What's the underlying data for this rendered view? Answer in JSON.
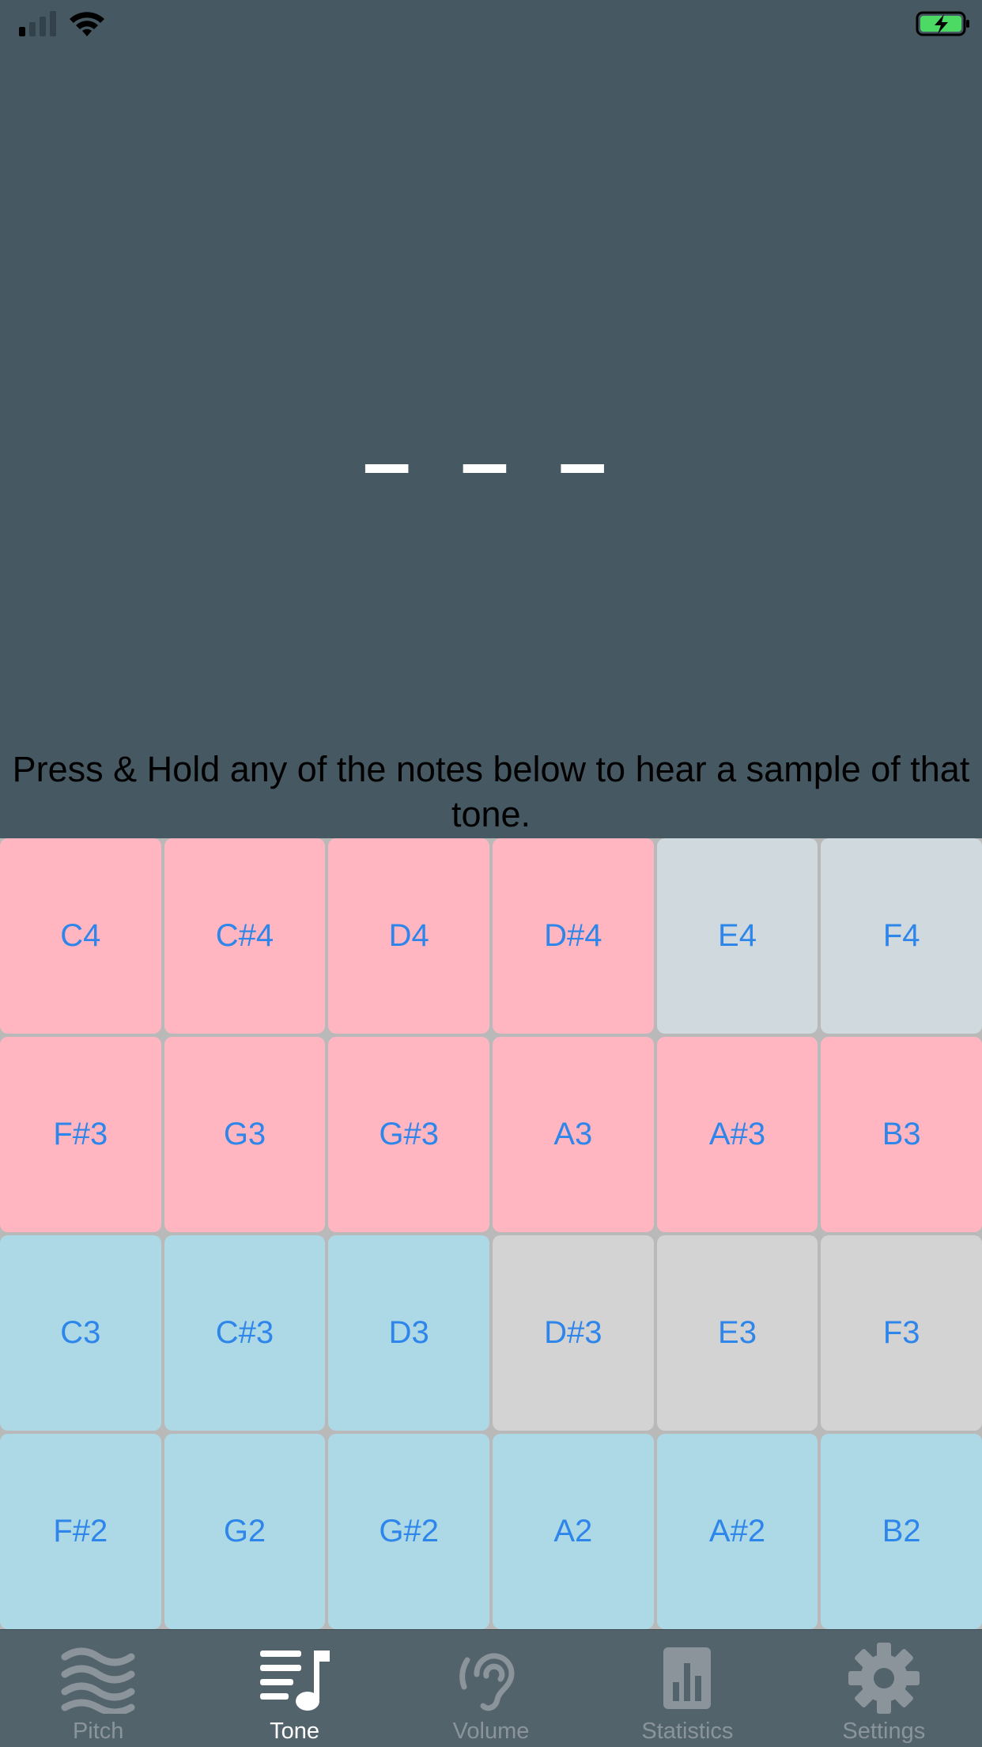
{
  "status_bar": {
    "signal_icon": "cell-signal-icon",
    "wifi_icon": "wifi-icon",
    "battery_icon": "battery-charging-icon",
    "battery_color": "#4cd964"
  },
  "display": {
    "placeholder": "– – –"
  },
  "instructions": "Press & Hold any of the notes below to hear a sample of that tone.",
  "keys": [
    {
      "label": "C4",
      "color": "pink"
    },
    {
      "label": "C#4",
      "color": "pink"
    },
    {
      "label": "D4",
      "color": "pink"
    },
    {
      "label": "D#4",
      "color": "pink"
    },
    {
      "label": "E4",
      "color": "grey"
    },
    {
      "label": "F4",
      "color": "grey"
    },
    {
      "label": "F#3",
      "color": "pink"
    },
    {
      "label": "G3",
      "color": "pink"
    },
    {
      "label": "G#3",
      "color": "pink"
    },
    {
      "label": "A3",
      "color": "pink"
    },
    {
      "label": "A#3",
      "color": "pink"
    },
    {
      "label": "B3",
      "color": "pink"
    },
    {
      "label": "C3",
      "color": "blue"
    },
    {
      "label": "C#3",
      "color": "blue"
    },
    {
      "label": "D3",
      "color": "blue"
    },
    {
      "label": "D#3",
      "color": "lightgrey"
    },
    {
      "label": "E3",
      "color": "lightgrey"
    },
    {
      "label": "F3",
      "color": "lightgrey"
    },
    {
      "label": "F#2",
      "color": "blue"
    },
    {
      "label": "G2",
      "color": "blue"
    },
    {
      "label": "G#2",
      "color": "blue"
    },
    {
      "label": "A2",
      "color": "blue"
    },
    {
      "label": "A#2",
      "color": "blue"
    },
    {
      "label": "B2",
      "color": "blue"
    }
  ],
  "colors": {
    "background": "#465862",
    "key_text": "#2e86ea",
    "pink": "#ffb6c1",
    "blue": "#add8e6",
    "grey": "#d0d9dd",
    "lightgrey": "#d3d3d3"
  },
  "tabs": [
    {
      "label": "Pitch",
      "icon": "waves-icon",
      "active": false
    },
    {
      "label": "Tone",
      "icon": "music-list-icon",
      "active": true
    },
    {
      "label": "Volume",
      "icon": "ear-icon",
      "active": false
    },
    {
      "label": "Statistics",
      "icon": "bar-chart-icon",
      "active": false
    },
    {
      "label": "Settings",
      "icon": "gear-icon",
      "active": false
    }
  ]
}
